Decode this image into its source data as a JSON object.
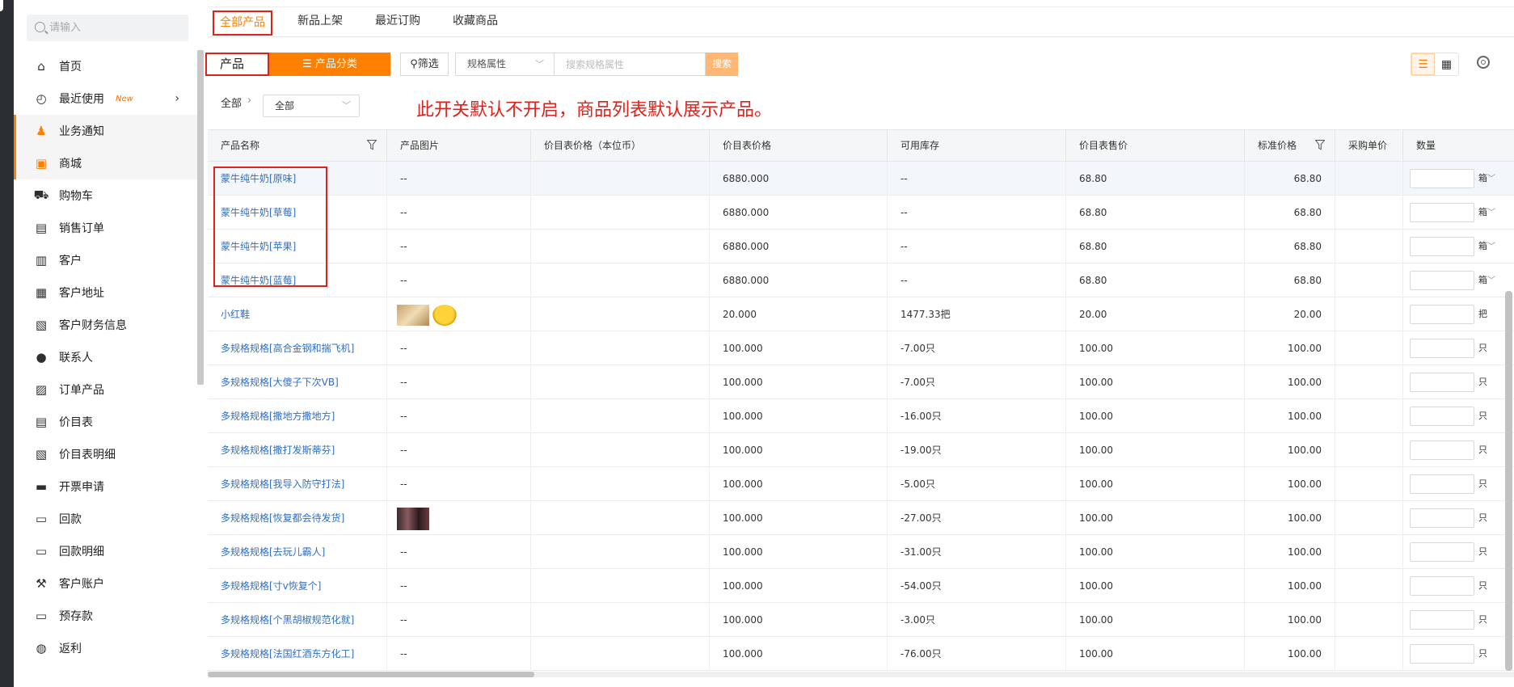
{
  "sidebar": {
    "search_placeholder": "请输入",
    "items": [
      {
        "label": "首页",
        "icon": "home-icon"
      },
      {
        "label": "最近使用",
        "icon": "clock-icon",
        "badge": "New"
      },
      {
        "label": "业务通知",
        "icon": "bell-icon"
      },
      {
        "label": "商城",
        "icon": "shop-icon"
      },
      {
        "label": "购物车",
        "icon": "cart-icon"
      },
      {
        "label": "销售订单",
        "icon": "order-icon"
      },
      {
        "label": "客户",
        "icon": "building-icon"
      },
      {
        "label": "客户地址",
        "icon": "address-icon"
      },
      {
        "label": "客户财务信息",
        "icon": "finance-icon"
      },
      {
        "label": "联系人",
        "icon": "contact-icon"
      },
      {
        "label": "订单产品",
        "icon": "order-product-icon"
      },
      {
        "label": "价目表",
        "icon": "list-icon"
      },
      {
        "label": "价目表明细",
        "icon": "list-detail-icon"
      },
      {
        "label": "开票申请",
        "icon": "invoice-icon"
      },
      {
        "label": "回款",
        "icon": "payment-icon"
      },
      {
        "label": "回款明细",
        "icon": "payment-detail-icon"
      },
      {
        "label": "客户账户",
        "icon": "wrench-icon"
      },
      {
        "label": "预存款",
        "icon": "deposit-icon"
      },
      {
        "label": "返利",
        "icon": "rebate-icon"
      }
    ]
  },
  "tabs": [
    "全部产品",
    "新品上架",
    "最近订购",
    "收藏商品"
  ],
  "toolbar": {
    "product_label": "产品",
    "category_label": "产品分类",
    "filter_label": "筛选",
    "spec_select": "规格属性",
    "spec_placeholder": "搜索规格属性",
    "search_label": "搜索"
  },
  "breadcrumb": {
    "root": "全部",
    "sep": "›",
    "select_value": "全部"
  },
  "notice": "此开关默认不开启，商品列表默认展示产品。",
  "table": {
    "headers": [
      "产品名称",
      "产品图片",
      "价目表价格（本位币）",
      "价目表价格",
      "可用库存",
      "价目表售价",
      "标准价格",
      "采购单价",
      "数量"
    ],
    "rows": [
      {
        "name": "蒙牛纯牛奶[原味]",
        "img": "--",
        "price": "6880.000",
        "stock": "--",
        "sale": "68.80",
        "std": "68.80",
        "unit": "箱"
      },
      {
        "name": "蒙牛纯牛奶[草莓]",
        "img": "--",
        "price": "6880.000",
        "stock": "--",
        "sale": "68.80",
        "std": "68.80",
        "unit": "箱"
      },
      {
        "name": "蒙牛纯牛奶[苹果]",
        "img": "--",
        "price": "6880.000",
        "stock": "--",
        "sale": "68.80",
        "std": "68.80",
        "unit": "箱"
      },
      {
        "name": "蒙牛纯牛奶[蓝莓]",
        "img": "--",
        "price": "6880.000",
        "stock": "--",
        "sale": "68.80",
        "std": "68.80",
        "unit": "箱"
      },
      {
        "name": "小红鞋",
        "img": "thumbs2",
        "price": "20.000",
        "stock": "1477.33把",
        "sale": "20.00",
        "std": "20.00",
        "unit": "把"
      },
      {
        "name": "多规格规格[高合金钢和揣飞机]",
        "img": "--",
        "price": "100.000",
        "stock": "-7.00只",
        "sale": "100.00",
        "std": "100.00",
        "unit": "只"
      },
      {
        "name": "多规格规格[大傻子下次VB]",
        "img": "--",
        "price": "100.000",
        "stock": "-7.00只",
        "sale": "100.00",
        "std": "100.00",
        "unit": "只"
      },
      {
        "name": "多规格规格[撒地方撒地方]",
        "img": "--",
        "price": "100.000",
        "stock": "-16.00只",
        "sale": "100.00",
        "std": "100.00",
        "unit": "只"
      },
      {
        "name": "多规格规格[撒打发斯蒂芬]",
        "img": "--",
        "price": "100.000",
        "stock": "-19.00只",
        "sale": "100.00",
        "std": "100.00",
        "unit": "只"
      },
      {
        "name": "多规格规格[我导入防守打法]",
        "img": "--",
        "price": "100.000",
        "stock": "-5.00只",
        "sale": "100.00",
        "std": "100.00",
        "unit": "只"
      },
      {
        "name": "多规格规格[恢复都会待发货]",
        "img": "thumb1",
        "price": "100.000",
        "stock": "-27.00只",
        "sale": "100.00",
        "std": "100.00",
        "unit": "只"
      },
      {
        "name": "多规格规格[去玩儿霸人]",
        "img": "--",
        "price": "100.000",
        "stock": "-31.00只",
        "sale": "100.00",
        "std": "100.00",
        "unit": "只"
      },
      {
        "name": "多规格规格[寸v恢复个]",
        "img": "--",
        "price": "100.000",
        "stock": "-54.00只",
        "sale": "100.00",
        "std": "100.00",
        "unit": "只"
      },
      {
        "name": "多规格规格[个黑胡椒规范化就]",
        "img": "--",
        "price": "100.000",
        "stock": "-3.00只",
        "sale": "100.00",
        "std": "100.00",
        "unit": "只"
      },
      {
        "name": "多规格规格[法国红酒东方化工]",
        "img": "--",
        "price": "100.000",
        "stock": "-76.00只",
        "sale": "100.00",
        "std": "100.00",
        "unit": "只"
      }
    ]
  },
  "colors": {
    "accent": "#ff7f00",
    "highlight": "#e0211b",
    "link": "#2f6fc4"
  }
}
